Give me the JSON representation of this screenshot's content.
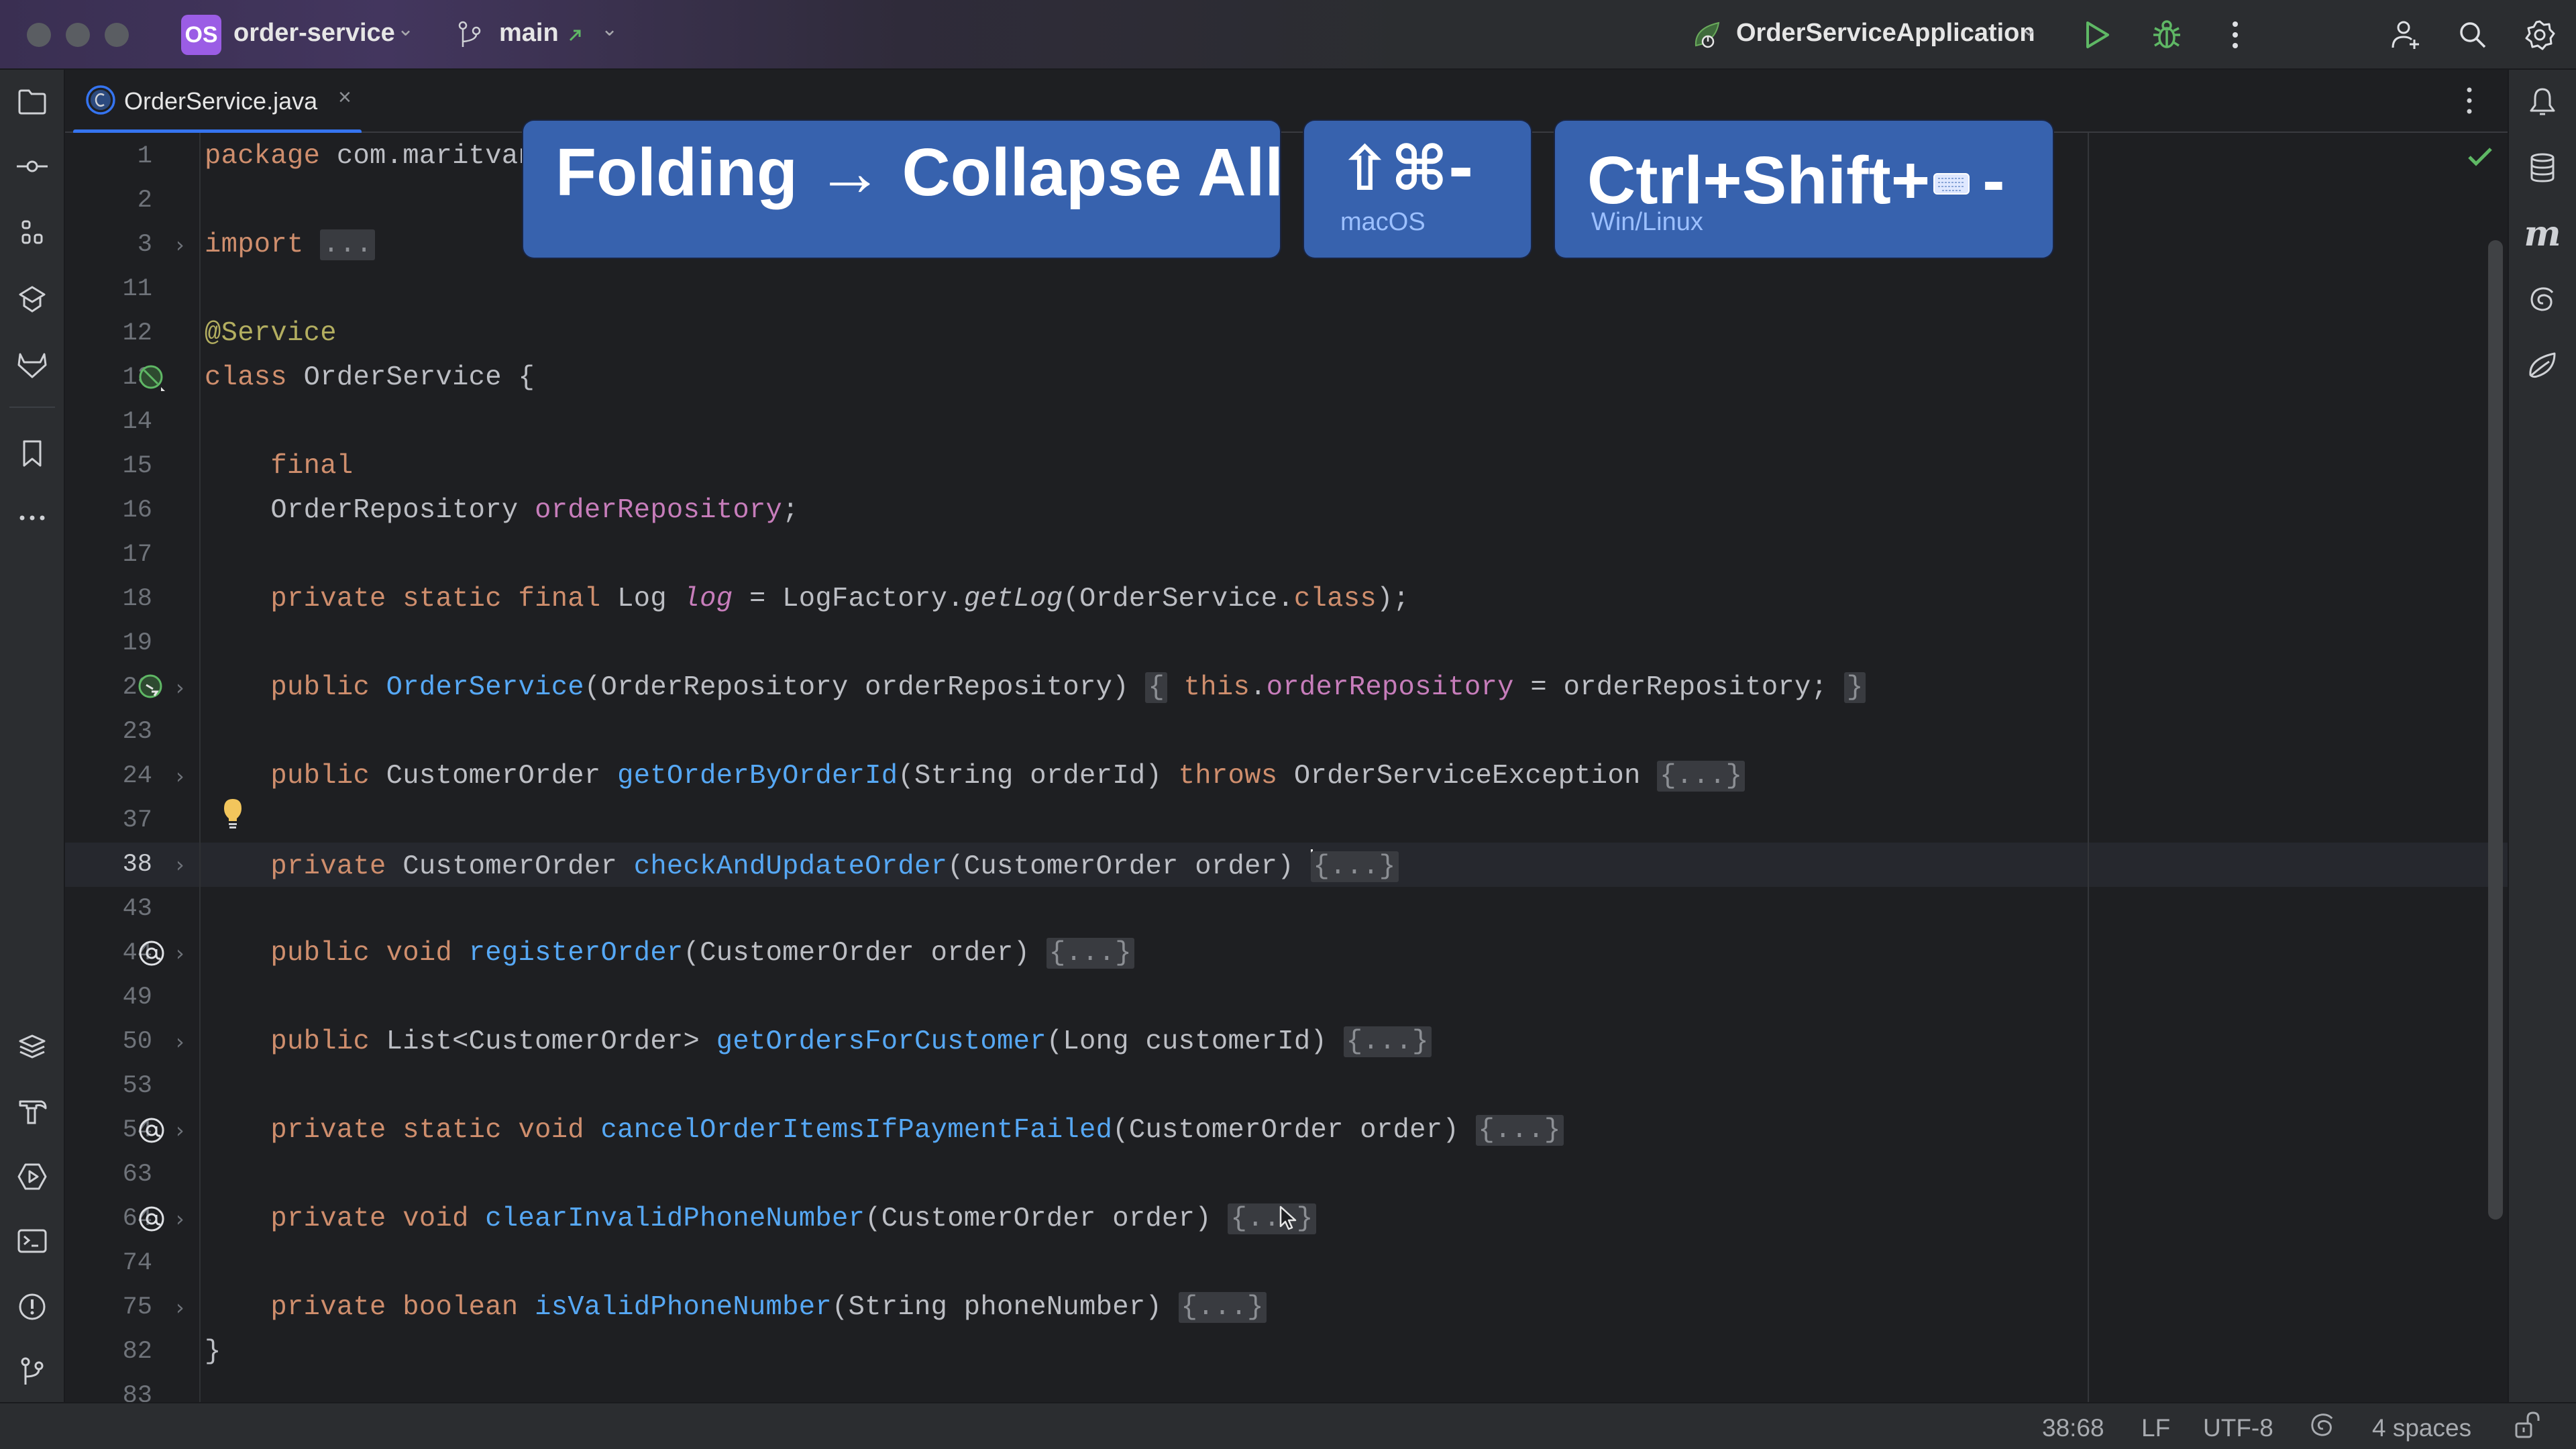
{
  "titlebar": {
    "project_badge": "OS",
    "project_name": "order-service",
    "branch_name": "main",
    "run_config": "OrderServiceApplication",
    "icons": [
      "git-branch-icon",
      "outgoing-arrow-icon",
      "spring-boot-icon",
      "run-icon",
      "debug-icon",
      "more-vertical-icon",
      "add-user-icon",
      "search-icon",
      "settings-gear-icon"
    ]
  },
  "tabs": [
    {
      "label": "OrderService.java",
      "icon": "java-class-icon",
      "active": true
    }
  ],
  "left_toolbar": {
    "top": [
      "project-folder-icon",
      "commit-icon",
      "structure-icon",
      "learn-icon",
      "gitlab-icon",
      "bookmarks-icon",
      "more-tools-icon"
    ],
    "bottom": [
      "services-layers-icon",
      "build-hammer-icon",
      "run-services-icon",
      "terminal-icon",
      "problems-icon",
      "git-icon"
    ]
  },
  "right_toolbar": [
    "notifications-bell-icon",
    "database-icon",
    "maven-icon",
    "ai-assistant-spiral-icon",
    "spring-leaf-icon"
  ],
  "overlay": {
    "action": "Folding → Collapse All",
    "mac_shortcut": "⇧⌘-",
    "mac_label": "macOS",
    "win_shortcut_prefix": "Ctrl+Shift+",
    "win_shortcut_key": "-",
    "win_label": "Win/Linux"
  },
  "editor": {
    "current_line": "38",
    "lines": [
      {
        "n": "1",
        "tokens": [
          [
            "kw",
            "package"
          ],
          [
            "",
            " com.maritvan"
          ]
        ]
      },
      {
        "n": "2",
        "tokens": []
      },
      {
        "n": "3",
        "fold": true,
        "tokens": [
          [
            "kw",
            "import"
          ],
          [
            "",
            " "
          ],
          [
            "fold-box",
            "..."
          ]
        ]
      },
      {
        "n": "11",
        "tokens": []
      },
      {
        "n": "12",
        "tokens": [
          [
            "ann",
            "@Service"
          ]
        ]
      },
      {
        "n": "13",
        "gutter": "spring-bean-icon",
        "tokens": [
          [
            "kw",
            "class"
          ],
          [
            "",
            " OrderService {"
          ]
        ]
      },
      {
        "n": "14",
        "tokens": []
      },
      {
        "n": "15",
        "tokens": [
          [
            "",
            "    "
          ],
          [
            "kw",
            "final"
          ]
        ]
      },
      {
        "n": "16",
        "tokens": [
          [
            "",
            "    OrderRepository "
          ],
          [
            "fld",
            "orderRepository"
          ],
          [
            "",
            ";"
          ]
        ]
      },
      {
        "n": "17",
        "tokens": []
      },
      {
        "n": "18",
        "tokens": [
          [
            "",
            "    "
          ],
          [
            "kw",
            "private static final"
          ],
          [
            "",
            " Log "
          ],
          [
            "fld it",
            "log"
          ],
          [
            "",
            " = LogFactory."
          ],
          [
            "it",
            "getLog"
          ],
          [
            "",
            "(OrderService."
          ],
          [
            "kw",
            "class"
          ],
          [
            "",
            ");"
          ]
        ]
      },
      {
        "n": "19",
        "tokens": []
      },
      {
        "n": "20",
        "gutter": "spring-inject-icon",
        "fold": true,
        "tokens": [
          [
            "",
            "    "
          ],
          [
            "kw",
            "public"
          ],
          [
            "",
            " "
          ],
          [
            "fn",
            "OrderService"
          ],
          [
            "",
            "(OrderRepository orderRepository) "
          ],
          [
            "fold-box",
            "{"
          ],
          [
            "",
            " "
          ],
          [
            "kw",
            "this"
          ],
          [
            "",
            "."
          ],
          [
            "fld",
            "orderRepository"
          ],
          [
            "",
            " = orderRepository; "
          ],
          [
            "fold-box",
            "}"
          ]
        ]
      },
      {
        "n": "23",
        "tokens": []
      },
      {
        "n": "24",
        "fold": true,
        "tokens": [
          [
            "",
            "    "
          ],
          [
            "kw",
            "public"
          ],
          [
            "",
            " CustomerOrder "
          ],
          [
            "fn",
            "getOrderByOrderId"
          ],
          [
            "",
            "(String orderId) "
          ],
          [
            "kw",
            "throws"
          ],
          [
            "",
            " OrderServiceException "
          ],
          [
            "fold-box",
            "{...}"
          ]
        ]
      },
      {
        "n": "37",
        "tokens": []
      },
      {
        "n": "38",
        "fold": true,
        "current": true,
        "tokens": [
          [
            "",
            "    "
          ],
          [
            "kw",
            "private"
          ],
          [
            "",
            " CustomerOrder "
          ],
          [
            "fn",
            "checkAndUpdateOrder"
          ],
          [
            "",
            "(CustomerOrder order) "
          ],
          [
            "caret",
            ""
          ],
          [
            "fold-box",
            "{...}"
          ]
        ]
      },
      {
        "n": "43",
        "tokens": []
      },
      {
        "n": "44",
        "gutter": "at-icon",
        "fold": true,
        "tokens": [
          [
            "",
            "    "
          ],
          [
            "kw",
            "public void"
          ],
          [
            "",
            " "
          ],
          [
            "fn",
            "registerOrder"
          ],
          [
            "",
            "(CustomerOrder order) "
          ],
          [
            "fold-box",
            "{...}"
          ]
        ]
      },
      {
        "n": "49",
        "tokens": []
      },
      {
        "n": "50",
        "fold": true,
        "tokens": [
          [
            "",
            "    "
          ],
          [
            "kw",
            "public"
          ],
          [
            "",
            " List<CustomerOrder> "
          ],
          [
            "fn",
            "getOrdersForCustomer"
          ],
          [
            "",
            "(Long customerId) "
          ],
          [
            "fold-box",
            "{...}"
          ]
        ]
      },
      {
        "n": "53",
        "tokens": []
      },
      {
        "n": "54",
        "gutter": "at-icon",
        "fold": true,
        "tokens": [
          [
            "",
            "    "
          ],
          [
            "kw",
            "private static void"
          ],
          [
            "",
            " "
          ],
          [
            "fn",
            "cancelOrderItemsIfPaymentFailed"
          ],
          [
            "",
            "(CustomerOrder order) "
          ],
          [
            "fold-box",
            "{...}"
          ]
        ]
      },
      {
        "n": "63",
        "tokens": []
      },
      {
        "n": "64",
        "gutter": "at-icon",
        "fold": true,
        "tokens": [
          [
            "",
            "    "
          ],
          [
            "kw",
            "private void"
          ],
          [
            "",
            " "
          ],
          [
            "fn",
            "clearInvalidPhoneNumber"
          ],
          [
            "",
            "(CustomerOrder order) "
          ],
          [
            "fold-box",
            "{...}"
          ]
        ]
      },
      {
        "n": "74",
        "tokens": []
      },
      {
        "n": "75",
        "fold": true,
        "tokens": [
          [
            "",
            "    "
          ],
          [
            "kw",
            "private boolean"
          ],
          [
            "",
            " "
          ],
          [
            "fn",
            "isValidPhoneNumber"
          ],
          [
            "",
            "(String phoneNumber) "
          ],
          [
            "fold-box",
            "{...}"
          ]
        ]
      },
      {
        "n": "82",
        "tokens": [
          [
            "",
            "}"
          ]
        ]
      },
      {
        "n": "83",
        "tokens": []
      }
    ]
  },
  "statusbar": {
    "position": "38:68",
    "line_separator": "LF",
    "encoding": "UTF-8",
    "indent": "4 spaces"
  },
  "colors": {
    "accent": "#3574f0",
    "overlay_bg": "#3762ae",
    "keyword": "#cf8e6d",
    "function": "#56a8f5",
    "field": "#c77dbb",
    "annotation": "#b3ae60",
    "success": "#5fb865"
  }
}
